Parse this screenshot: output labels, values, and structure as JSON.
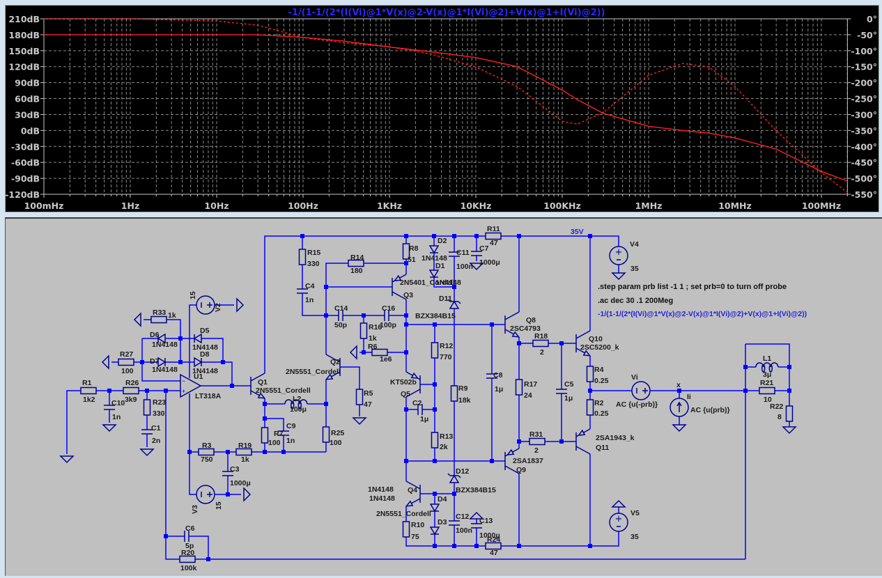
{
  "plot": {
    "trace_expression": "-1/(1-1/(2*(I(Vi)@1*V(x)@2-V(x)@1*I(Vi)@2)+V(x)@1+I(Vi)@2))",
    "trace_color": "#ff2020",
    "background": "#000000"
  },
  "chart_data": {
    "type": "line",
    "title": "-1/(1-1/(2*(I(Vi)@1*V(x)@2-V(x)@1*I(Vi)@2)+V(x)@1+I(Vi)@2))",
    "x_scale": "log",
    "xlim": [
      0.1,
      200000000
    ],
    "x_ticks": [
      0.1,
      1,
      10,
      100,
      1000,
      10000,
      100000,
      1000000,
      10000000,
      100000000
    ],
    "x_tick_labels": [
      "100mHz",
      "1Hz",
      "10Hz",
      "100Hz",
      "1KHz",
      "10KHz",
      "100KHz",
      "1MHz",
      "10MHz",
      "100MHz"
    ],
    "ylim_left": [
      -120,
      210
    ],
    "y_left_ticks": [
      210,
      180,
      150,
      120,
      90,
      60,
      30,
      0,
      -30,
      -60,
      -90,
      -120
    ],
    "y_left_tick_labels": [
      "210dB",
      "180dB",
      "150dB",
      "120dB",
      "90dB",
      "60dB",
      "30dB",
      "0dB",
      "-30dB",
      "-60dB",
      "-90dB",
      "-120dB"
    ],
    "ylim_right": [
      -550,
      0
    ],
    "y_right_ticks": [
      0,
      -50,
      -100,
      -150,
      -200,
      -250,
      -300,
      -350,
      -400,
      -450,
      -500,
      -550
    ],
    "y_right_tick_labels": [
      "0°",
      "-50°",
      "-100°",
      "-150°",
      "-200°",
      "-250°",
      "-300°",
      "-350°",
      "-400°",
      "-450°",
      "-500°",
      "-550°"
    ],
    "grid": true,
    "x": [
      0.1,
      1,
      10,
      30,
      100,
      300,
      1000,
      3000,
      10000,
      30000,
      100000,
      150000,
      300000,
      1000000,
      2500000,
      5000000,
      10000000,
      30000000,
      100000000,
      200000000
    ],
    "series": [
      {
        "axis": "left",
        "style": "solid",
        "color": "#ff2020",
        "values": [
          180,
          180,
          180,
          180,
          175,
          168,
          157,
          148,
          137,
          120,
          76,
          58,
          32,
          8,
          0,
          -5,
          -14,
          -35,
          -77,
          -95
        ]
      },
      {
        "axis": "right",
        "style": "dashed",
        "color": "#ff2020",
        "values": [
          0,
          0,
          -7,
          -20,
          -59,
          -75,
          -88,
          -110,
          -151,
          -212,
          -321,
          -330,
          -293,
          -177,
          -140,
          -151,
          -212,
          -351,
          -482,
          -544
        ]
      }
    ]
  },
  "schematic": {
    "wire_color": "#0000ff",
    "component_color": "#000090",
    "background": "#c0c0c0",
    "net_label": "35V",
    "node_label": "x",
    "directives": [
      ".step param prb list -1 1 ; set prb=0 to turn off probe",
      ".ac dec 30 .1 200Meg",
      "-1/(1-1/(2*(I(Vi)@1*V(x)@2-V(x)@1*I(Vi)@2)+V(x)@1+I(Vi)@2))"
    ],
    "parts": {
      "R1": {
        "name": "R1",
        "value": "1k2"
      },
      "R26": {
        "name": "R26",
        "value": "3k9"
      },
      "C10": {
        "name": "C10",
        "value": "1n"
      },
      "R23": {
        "name": "R23",
        "value": "330"
      },
      "C1": {
        "name": "C1",
        "value": "2n"
      },
      "R27": {
        "name": "R27",
        "value": "100"
      },
      "R33": {
        "name": "R33",
        "value": "1k"
      },
      "D6": {
        "name": "D6",
        "value": "1N4148"
      },
      "D7": {
        "name": "D7",
        "value": "1N4148"
      },
      "D5": {
        "name": "D5",
        "value": "1N4148"
      },
      "D8": {
        "name": "D8",
        "value": "1N4148"
      },
      "U1": {
        "name": "U1",
        "value": "LT318A"
      },
      "V2": {
        "name": "V2",
        "value": "15"
      },
      "V3": {
        "name": "V3",
        "value": "15"
      },
      "Q1": {
        "name": "Q1",
        "value": "2N5551_Cordell"
      },
      "L2": {
        "name": "L2",
        "value": "100μ"
      },
      "R7": {
        "name": "R7",
        "value": "100"
      },
      "C9": {
        "name": "C9",
        "value": "1n"
      },
      "R25": {
        "name": "R25",
        "value": "100"
      },
      "Q2": {
        "name": "Q2",
        "value": "2N5551_Cordell"
      },
      "R5": {
        "name": "R5",
        "value": "47"
      },
      "R3": {
        "name": "R3",
        "value": "750"
      },
      "R19": {
        "name": "R19",
        "value": "1k"
      },
      "C3": {
        "name": "C3",
        "value": "1000μ"
      },
      "C6": {
        "name": "C6",
        "value": "5p"
      },
      "R20": {
        "name": "R20",
        "value": "100k"
      },
      "R15": {
        "name": "R15",
        "value": "330"
      },
      "C4": {
        "name": "C4",
        "value": "1n"
      },
      "R14": {
        "name": "R14",
        "value": "180"
      },
      "C14": {
        "name": "C14",
        "value": "50p"
      },
      "C16": {
        "name": "C16",
        "value": "100p"
      },
      "R16": {
        "name": "R16",
        "value": "1k"
      },
      "R6": {
        "name": "R6",
        "value": "1e6"
      },
      "R8": {
        "name": "R8",
        "value": "51"
      },
      "Q3": {
        "name": "Q3",
        "value": "2N5401_Cordell"
      },
      "D2": {
        "name": "D2",
        "value": "1N4148"
      },
      "D1": {
        "name": "D1",
        "value": "1N4148"
      },
      "C11": {
        "name": "C11",
        "value": "100n"
      },
      "C7": {
        "name": "C7",
        "value": "1000μ"
      },
      "R11": {
        "name": "R11",
        "value": "47"
      },
      "D11": {
        "name": "D11",
        "value": "BZX384B15"
      },
      "R12": {
        "name": "R12",
        "value": "770"
      },
      "Q5": {
        "name": "Q5",
        "value": "KT502b"
      },
      "C2": {
        "name": "C2",
        "value": "1μ"
      },
      "R13": {
        "name": "R13",
        "value": "2k"
      },
      "R9": {
        "name": "R9",
        "value": "18k"
      },
      "C8": {
        "name": "C8",
        "value": "1μ"
      },
      "D12": {
        "name": "D12",
        "value": "BZX384B15"
      },
      "Q4": {
        "name": "Q4",
        "value": "2N5551_Cordell"
      },
      "D4": {
        "name": "D4",
        "value": "1N4148"
      },
      "D3": {
        "name": "D3",
        "value": "1N4148"
      },
      "R10": {
        "name": "R10",
        "value": "75"
      },
      "C12": {
        "name": "C12",
        "value": "100n"
      },
      "C13": {
        "name": "C13",
        "value": "1000μ"
      },
      "R24": {
        "name": "R24",
        "value": "47"
      },
      "V4": {
        "name": "V4",
        "value": "35"
      },
      "V5": {
        "name": "V5",
        "value": "35"
      },
      "Q8": {
        "name": "Q8",
        "value": "2SC4793"
      },
      "R18": {
        "name": "R18",
        "value": "2"
      },
      "R17": {
        "name": "R17",
        "value": "24"
      },
      "C5": {
        "name": "C5",
        "value": "1μ"
      },
      "R31": {
        "name": "R31",
        "value": "2"
      },
      "Q9": {
        "name": "Q9",
        "value": "2SA1837"
      },
      "Q10": {
        "name": "Q10",
        "value": "2SC5200_k"
      },
      "Q11": {
        "name": "Q11",
        "value": "2SA1943_k"
      },
      "R4": {
        "name": "R4",
        "value": "0.25"
      },
      "R2": {
        "name": "R2",
        "value": "0.25"
      },
      "Vi": {
        "name": "Vi",
        "value": "AC {u(-prb)}"
      },
      "Ii": {
        "name": "Ii",
        "value": "AC {u(prb)}"
      },
      "L1": {
        "name": "L1",
        "value": "3μ"
      },
      "R21": {
        "name": "R21",
        "value": "10"
      },
      "R22": {
        "name": "R22",
        "value": "8"
      }
    }
  }
}
